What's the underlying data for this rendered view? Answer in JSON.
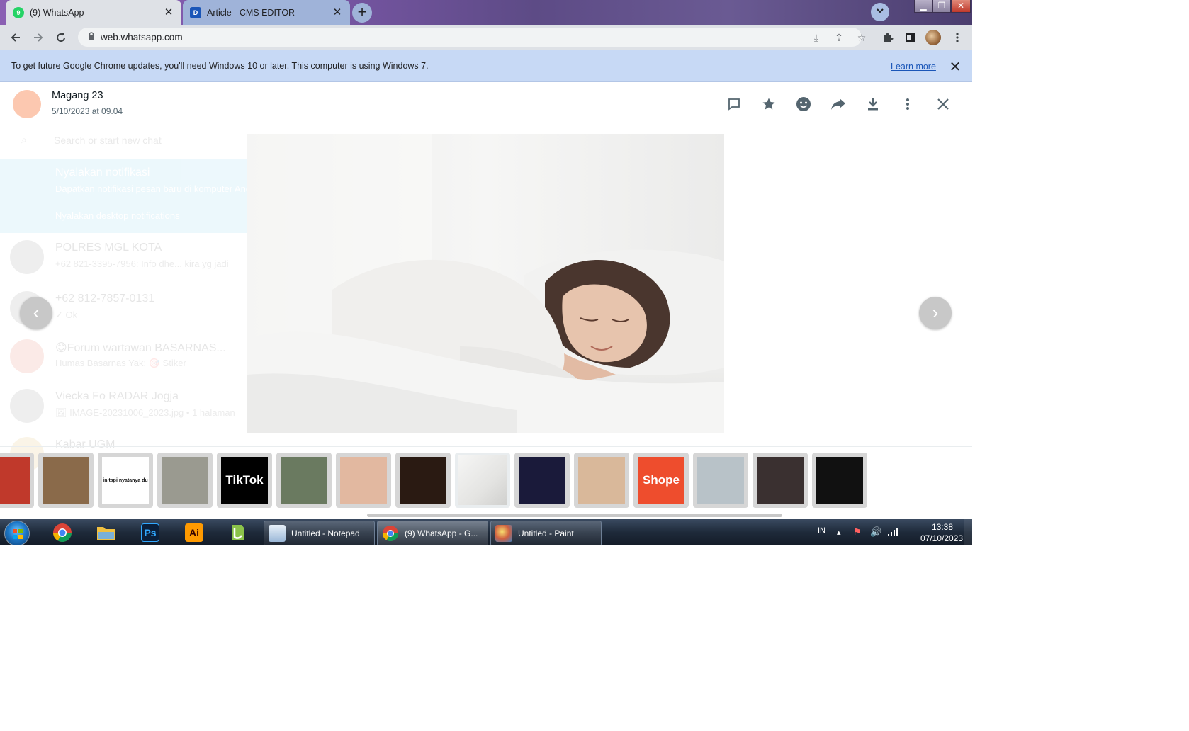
{
  "browser": {
    "tabs": [
      {
        "label": "(9) WhatsApp",
        "favicon": "whatsapp-icon",
        "active": true
      },
      {
        "label": "Article - CMS EDITOR",
        "favicon": "cms-icon",
        "active": false
      }
    ],
    "new_tab": "+",
    "tab_close": "✕",
    "url": "web.whatsapp.com"
  },
  "infobar": {
    "message": "To get future Google Chrome updates, you'll need Windows 10 or later. This computer is using Windows 7.",
    "link": "Learn more",
    "close": "✕"
  },
  "background_chats": {
    "search_placeholder": "Search or start new chat",
    "notification": {
      "title": "Nyalakan notifikasi",
      "body": "Dapatkan notifikasi pesan baru di komputer Anda",
      "link": "Nyalakan desktop notifications"
    },
    "chats": [
      {
        "name": "POLRES MGL KOTA",
        "preview": "+62 821-3395-7956: Info dhe... kira yg jadi"
      },
      {
        "name": "+62 812-7857-0131",
        "preview": "✓ Ok"
      },
      {
        "name": "😊Forum wartawan BASARNAS...",
        "preview": "Humas Basarnas Yak: 🎯 Stiker"
      },
      {
        "name": "Viecka Fo RADAR Jogja",
        "preview": "🖼 IMAGE-20231006_2023.jpg • 1 halaman"
      },
      {
        "name": "Kabar UGM",
        "preview": ""
      }
    ]
  },
  "media_viewer": {
    "sender": "Magang 23",
    "date": "5/10/2023 at 09.04",
    "header_icons": [
      "reply-icon",
      "star-icon",
      "emoji-icon",
      "forward-icon",
      "download-icon",
      "more-icon",
      "close-icon"
    ],
    "prev": "‹",
    "next": "›",
    "thumbnails": [
      {
        "name": "thumb-football",
        "color": "#c0392b",
        "text": ""
      },
      {
        "name": "thumb-people",
        "color": "#8a6a4a",
        "text": ""
      },
      {
        "name": "thumb-text",
        "color": "#ffffff",
        "text": "in tapi nyatanya du"
      },
      {
        "name": "thumb-building",
        "color": "#9a9a90",
        "text": ""
      },
      {
        "name": "thumb-tiktok",
        "color": "#000000",
        "text": "TikTok"
      },
      {
        "name": "thumb-crowd",
        "color": "#6a7a60",
        "text": ""
      },
      {
        "name": "thumb-neck",
        "color": "#e2b8a0",
        "text": ""
      },
      {
        "name": "thumb-poster",
        "color": "#2a1a12",
        "text": ""
      },
      {
        "name": "thumb-sleeping",
        "color": "#efefef",
        "text": "",
        "selected": true
      },
      {
        "name": "thumb-event",
        "color": "#1a1a3a",
        "text": ""
      },
      {
        "name": "thumb-bedroom",
        "color": "#d9b89a",
        "text": ""
      },
      {
        "name": "thumb-shopee",
        "color": "#ee4d2d",
        "text": "Shope"
      },
      {
        "name": "thumb-street",
        "color": "#b8c2c8",
        "text": ""
      },
      {
        "name": "thumb-dark",
        "color": "#3a3030",
        "text": ""
      },
      {
        "name": "thumb-sign",
        "color": "#111111",
        "text": ""
      }
    ]
  },
  "taskbar": {
    "tasks": [
      {
        "label": "Untitled - Notepad",
        "icon": "notepad-icon"
      },
      {
        "label": "(9) WhatsApp - G...",
        "icon": "chrome-icon",
        "active": true
      },
      {
        "label": "Untitled - Paint",
        "icon": "paint-icon"
      }
    ],
    "pins": [
      {
        "name": "chrome-pin",
        "text": ""
      },
      {
        "name": "explorer-pin",
        "text": ""
      },
      {
        "name": "photoshop-pin",
        "text": "Ps"
      },
      {
        "name": "illustrator-pin",
        "text": "Ai"
      },
      {
        "name": "app-pin",
        "text": ""
      }
    ],
    "lang": "IN",
    "time": "13:38",
    "date": "07/10/2023"
  }
}
